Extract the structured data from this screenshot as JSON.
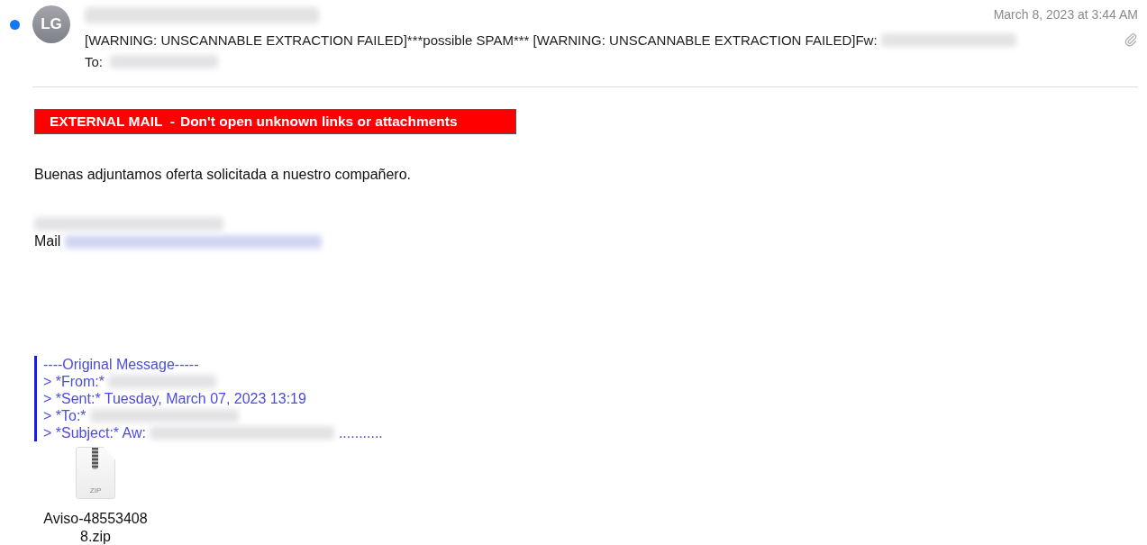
{
  "message": {
    "unread": true,
    "avatar_initials": "LG",
    "sender": [
      {
        "kind": "redacted"
      }
    ],
    "date": "March 8, 2023 at 3:44 AM",
    "has_attachment": true,
    "subject": [
      {
        "kind": "text",
        "text": "[WARNING: UNSCANNABLE EXTRACTION FAILED]***possible SPAM*** [WARNING: UNSCANNABLE EXTRACTION FAILED]Fw: "
      },
      {
        "kind": "redacted"
      }
    ],
    "to_label": "To:",
    "to": [
      {
        "kind": "redacted"
      }
    ]
  },
  "banner": {
    "label": "EXTERNAL MAIL  -",
    "link": "Don't open unknown links or attachments"
  },
  "body": {
    "greeting": "Buenas adjuntamos oferta solicitada a nuestro compañero.",
    "signature": [
      [
        {
          "kind": "redacted"
        }
      ],
      [
        {
          "kind": "text",
          "text": "Mail "
        },
        {
          "kind": "redacted"
        }
      ]
    ]
  },
  "quote": [
    [
      {
        "kind": "text",
        "text": "----Original Message-----"
      }
    ],
    [
      {
        "kind": "text",
        "text": "> *From:* "
      },
      {
        "kind": "redacted"
      }
    ],
    [
      {
        "kind": "text",
        "text": "> *Sent:* Tuesday, March 07, 2023 13:19"
      }
    ],
    [
      {
        "kind": "text",
        "text": "> *To:* "
      },
      {
        "kind": "redacted"
      }
    ],
    [
      {
        "kind": "text",
        "text": "> *Subject:* Aw: "
      },
      {
        "kind": "redacted"
      },
      {
        "kind": "text",
        "text": " ..........."
      }
    ]
  ],
  "attachment": {
    "type_label": "ZIP",
    "filename": "Aviso-485534088.zip"
  }
}
